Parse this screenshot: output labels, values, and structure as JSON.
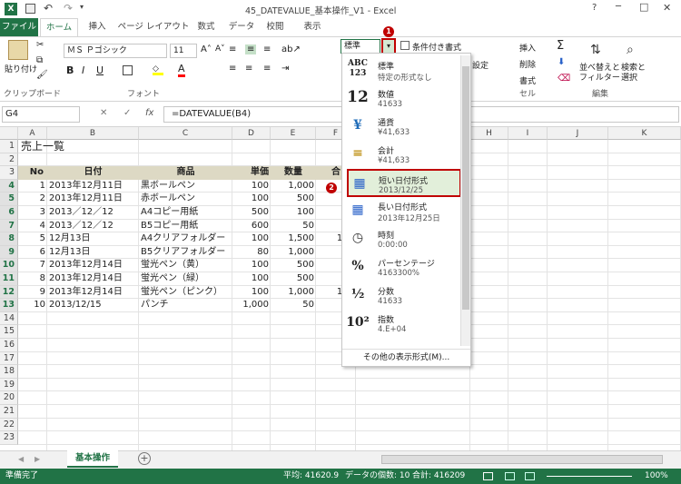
{
  "title": "45_DATEVALUE_基本操作_V1 - Excel",
  "window_buttons": {
    "help": "?",
    "min": "─",
    "max": "□",
    "close": "✕"
  },
  "tabs": [
    "ファイル",
    "ホーム",
    "挿入",
    "ページ レイアウト",
    "数式",
    "データ",
    "校閲",
    "表示"
  ],
  "ribbon": {
    "paste": "貼り付け",
    "clipboard": "クリップボード",
    "font_name": "ＭＳ Ｐゴシック",
    "font_size": "11",
    "bold": "B",
    "italic": "I",
    "underline": "U",
    "font_group": "フォント",
    "number_format": "標準",
    "cond_format": "条件付き書式",
    "settings": "設定",
    "insert": "挿入",
    "delete": "削除",
    "format": "書式",
    "cells": "セル",
    "sort_filter": "並べ替えと\nフィルター",
    "find_select": "検索と\n選択",
    "editing": "編集"
  },
  "name_box": "G4",
  "formula": "=DATEVALUE(B4)",
  "columns": [
    "A",
    "B",
    "C",
    "D",
    "E",
    "F",
    "G",
    "H",
    "I",
    "J",
    "K"
  ],
  "rows": [
    "1",
    "2",
    "3",
    "4",
    "5",
    "6",
    "7",
    "8",
    "9",
    "10",
    "11",
    "12",
    "13",
    "14",
    "15",
    "16",
    "17",
    "18",
    "19",
    "20",
    "21",
    "22",
    "23"
  ],
  "sheet_title": "売上一覧",
  "headers": [
    "No",
    "日付",
    "商品",
    "単価",
    "数量",
    "合"
  ],
  "data": [
    [
      "1",
      "2013年12月11日",
      "黒ボールペン",
      "100",
      "1,000",
      "5"
    ],
    [
      "2",
      "2013年12月11日",
      "赤ボールペン",
      "100",
      "500",
      "5"
    ],
    [
      "3",
      "2013／12／12",
      "A4コピー用紙",
      "500",
      "100",
      "50"
    ],
    [
      "4",
      "2013／12／12",
      "B5コピー用紙",
      "600",
      "50",
      "30"
    ],
    [
      "5",
      "12月13日",
      "A4クリアフォルダー",
      "100",
      "1,500",
      "150"
    ],
    [
      "6",
      "12月13日",
      "B5クリアフォルダー",
      "80",
      "1,000",
      "80"
    ],
    [
      "7",
      "2013年12月14日",
      "蛍光ペン（黄）",
      "100",
      "500",
      "50"
    ],
    [
      "8",
      "2013年12月14日",
      "蛍光ペン（緑）",
      "100",
      "500",
      "50"
    ],
    [
      "9",
      "2013年12月14日",
      "蛍光ペン（ピンク）",
      "100",
      "1,000",
      "100"
    ],
    [
      "10",
      "2013/12/15",
      "パンチ",
      "1,000",
      "50",
      "50"
    ]
  ],
  "dropdown": [
    {
      "icon": "ABC 123",
      "name": "標準",
      "sample": "特定の形式なし"
    },
    {
      "icon": "12",
      "name": "数値",
      "sample": "41633"
    },
    {
      "icon": "¥",
      "name": "通貨",
      "sample": "¥41,633"
    },
    {
      "icon": "≡",
      "name": "会計",
      "sample": " ¥41,633"
    },
    {
      "icon": "▦",
      "name": "短い日付形式",
      "sample": "2013/12/25"
    },
    {
      "icon": "▦",
      "name": "長い日付形式",
      "sample": "2013年12月25日"
    },
    {
      "icon": "◷",
      "name": "時刻",
      "sample": "0:00:00"
    },
    {
      "icon": "%",
      "name": "パーセンテージ",
      "sample": "4163300%"
    },
    {
      "icon": "½",
      "name": "分数",
      "sample": "41633"
    },
    {
      "icon": "10²",
      "name": "指数",
      "sample": "4.E+04"
    }
  ],
  "more_formats": "その他の表示形式(M)...",
  "callouts": [
    "1",
    "2"
  ],
  "sheet_tab": "基本操作",
  "status": {
    "ready": "準備完了",
    "avg": "平均: 41620.9",
    "count": "データの個数: 10",
    "sum": "合計: 416209",
    "zoom": "100%"
  },
  "colors": {
    "excel_green": "#217346",
    "header_fill": "#ddd9c4",
    "highlight": "#e2efda",
    "callout_red": "#c00000"
  }
}
